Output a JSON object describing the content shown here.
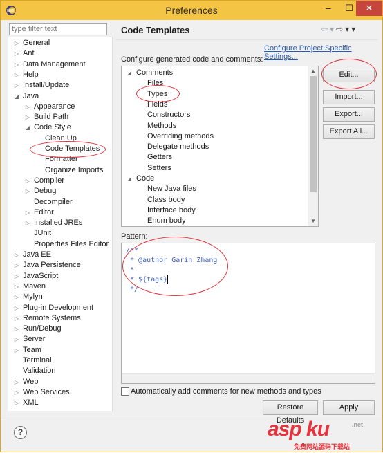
{
  "window": {
    "title": "Preferences",
    "minimize_glyph": "–",
    "maximize_glyph": "☐",
    "close_glyph": "✕"
  },
  "filter": {
    "placeholder": "type filter text"
  },
  "nav_tree": {
    "items": [
      {
        "label": "General",
        "expander": "collapsed"
      },
      {
        "label": "Ant",
        "expander": "collapsed"
      },
      {
        "label": "Data Management",
        "expander": "collapsed"
      },
      {
        "label": "Help",
        "expander": "collapsed"
      },
      {
        "label": "Install/Update",
        "expander": "collapsed"
      },
      {
        "label": "Java",
        "expander": "expanded"
      },
      {
        "label": "Appearance",
        "expander": "collapsed"
      },
      {
        "label": "Build Path",
        "expander": "collapsed"
      },
      {
        "label": "Code Style",
        "expander": "expanded"
      },
      {
        "label": "Clean Up",
        "expander": "none"
      },
      {
        "label": "Code Templates",
        "expander": "none",
        "selected": true
      },
      {
        "label": "Formatter",
        "expander": "none"
      },
      {
        "label": "Organize Imports",
        "expander": "none"
      },
      {
        "label": "Compiler",
        "expander": "collapsed"
      },
      {
        "label": "Debug",
        "expander": "collapsed"
      },
      {
        "label": "Decompiler",
        "expander": "none"
      },
      {
        "label": "Editor",
        "expander": "collapsed"
      },
      {
        "label": "Installed JREs",
        "expander": "collapsed"
      },
      {
        "label": "JUnit",
        "expander": "none"
      },
      {
        "label": "Properties Files Editor",
        "expander": "none"
      },
      {
        "label": "Java EE",
        "expander": "collapsed"
      },
      {
        "label": "Java Persistence",
        "expander": "collapsed"
      },
      {
        "label": "JavaScript",
        "expander": "collapsed"
      },
      {
        "label": "Maven",
        "expander": "collapsed"
      },
      {
        "label": "Mylyn",
        "expander": "collapsed"
      },
      {
        "label": "Plug-in Development",
        "expander": "collapsed"
      },
      {
        "label": "Remote Systems",
        "expander": "collapsed"
      },
      {
        "label": "Run/Debug",
        "expander": "collapsed"
      },
      {
        "label": "Server",
        "expander": "collapsed"
      },
      {
        "label": "Team",
        "expander": "collapsed"
      },
      {
        "label": "Terminal",
        "expander": "none"
      },
      {
        "label": "Validation",
        "expander": "none"
      },
      {
        "label": "Web",
        "expander": "collapsed"
      },
      {
        "label": "Web Services",
        "expander": "collapsed"
      },
      {
        "label": "XML",
        "expander": "collapsed"
      }
    ]
  },
  "page": {
    "title": "Code Templates",
    "config_link": "Configure Project Specific Settings...",
    "config_label": "Configure generated code and comments:",
    "pattern_label": "Pattern:"
  },
  "template_tree": {
    "items": [
      {
        "label": "Comments",
        "expander": "expanded"
      },
      {
        "label": "Files",
        "expander": "none"
      },
      {
        "label": "Types",
        "expander": "none",
        "selected": true
      },
      {
        "label": "Fields",
        "expander": "none"
      },
      {
        "label": "Constructors",
        "expander": "none"
      },
      {
        "label": "Methods",
        "expander": "none"
      },
      {
        "label": "Overriding methods",
        "expander": "none"
      },
      {
        "label": "Delegate methods",
        "expander": "none"
      },
      {
        "label": "Getters",
        "expander": "none"
      },
      {
        "label": "Setters",
        "expander": "none"
      },
      {
        "label": "Code",
        "expander": "expanded"
      },
      {
        "label": "New Java files",
        "expander": "none"
      },
      {
        "label": "Class body",
        "expander": "none"
      },
      {
        "label": "Interface body",
        "expander": "none"
      },
      {
        "label": "Enum body",
        "expander": "none"
      }
    ]
  },
  "buttons": {
    "edit": "Edit...",
    "import": "Import...",
    "export": "Export...",
    "export_all": "Export All...",
    "restore_defaults": "Restore Defaults",
    "apply": "Apply"
  },
  "pattern": {
    "lines": [
      "/**",
      " * @author Garin Zhang",
      " * ",
      " * ${tags}",
      " */"
    ]
  },
  "auto_comments": {
    "label": "Automatically add comments for new methods and types",
    "checked": false
  },
  "watermark": {
    "text": "asp ku",
    "subtext": "免费网站源码下载站",
    "suffix": ".net"
  },
  "colors": {
    "titlebar": "#f4c544",
    "annotation": "#e0303a",
    "link": "#2a5db0",
    "code_comment": "#3f5fbf"
  }
}
